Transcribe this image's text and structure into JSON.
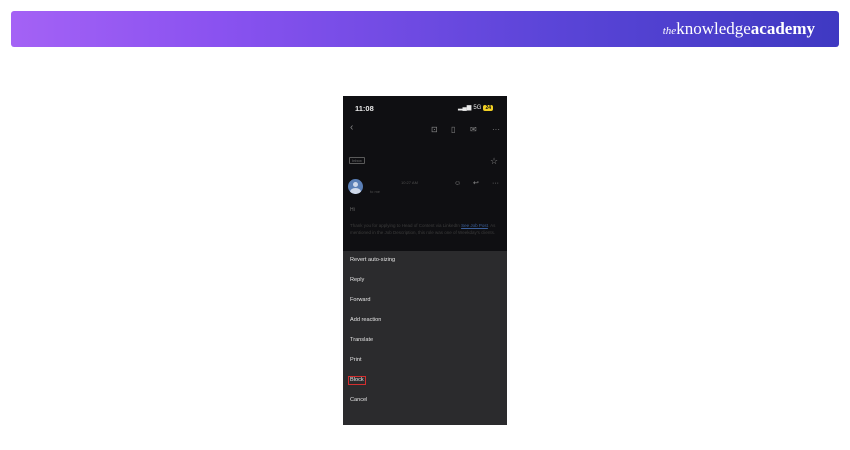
{
  "banner": {
    "brand_prefix": "the",
    "brand_main": "knowledge",
    "brand_bold": "academy"
  },
  "status_bar": {
    "time": "11:08",
    "signal": "5G",
    "battery": "24"
  },
  "email": {
    "inbox_label": "Inbox",
    "time": "10:27 AM",
    "to_label": "to me",
    "greeting": "Hi",
    "para1_before": "Thank you for applying to Head of Content via LinkedIn ",
    "para1_link": "See Job Post",
    "para1_after": ". As mentioned in the Job Description, this role was one of Weekday's clients.",
    "para2": "You can track the status of your application here and see the hiring company name."
  },
  "menu": {
    "items": [
      "Revert auto-sizing",
      "Reply",
      "Forward",
      "Add reaction",
      "Translate",
      "Print",
      "Block",
      "Cancel"
    ],
    "highlighted": "Block"
  },
  "icons": [
    "back-icon",
    "archive-icon",
    "trash-icon",
    "mail-icon",
    "more-icon",
    "star-icon",
    "emoji-icon",
    "reply-icon"
  ],
  "colors": {
    "banner_start": "#a462f5",
    "banner_end": "#3f39c2",
    "highlight": "#d32f2f",
    "sheet_bg": "#2b2b2d"
  }
}
